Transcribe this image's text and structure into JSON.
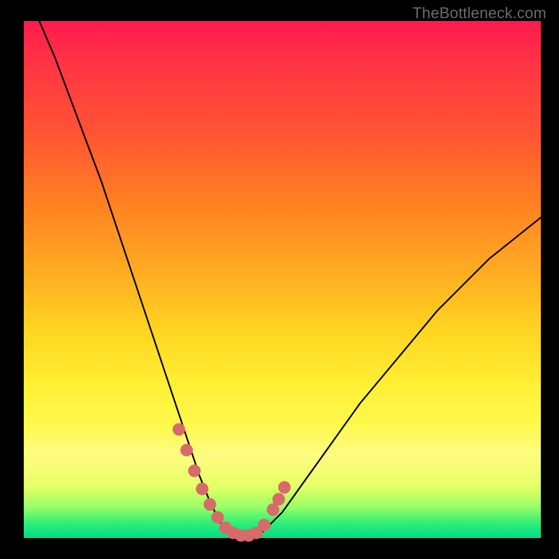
{
  "watermark": "TheBottleneck.com",
  "chart_data": {
    "type": "line",
    "title": "",
    "xlabel": "",
    "ylabel": "",
    "xlim": [
      0,
      100
    ],
    "ylim": [
      0,
      100
    ],
    "grid": false,
    "series": [
      {
        "name": "curve",
        "x": [
          3,
          6,
          9,
          12,
          15,
          18,
          21,
          24,
          27,
          30,
          32,
          34,
          36,
          38,
          40,
          42,
          44,
          46,
          50,
          55,
          60,
          65,
          70,
          75,
          80,
          85,
          90,
          95,
          100
        ],
        "y": [
          100,
          93,
          85,
          77,
          69,
          60,
          51,
          42,
          33,
          24,
          18,
          12,
          7,
          3,
          1,
          0,
          0,
          1,
          5,
          12,
          19,
          26,
          32,
          38,
          44,
          49,
          54,
          58,
          62
        ],
        "color": "#000000"
      },
      {
        "name": "highlight-dots",
        "x": [
          30,
          31.5,
          33,
          34.5,
          36,
          37.5,
          39,
          40.5,
          42,
          43.5,
          45,
          46.5,
          48.2,
          49.3,
          50.4
        ],
        "y": [
          21,
          17,
          13,
          9.5,
          6.5,
          4,
          2,
          1,
          0.5,
          0.5,
          1,
          2.5,
          5.5,
          7.5,
          9.8
        ],
        "color": "#d86a6a"
      }
    ]
  }
}
